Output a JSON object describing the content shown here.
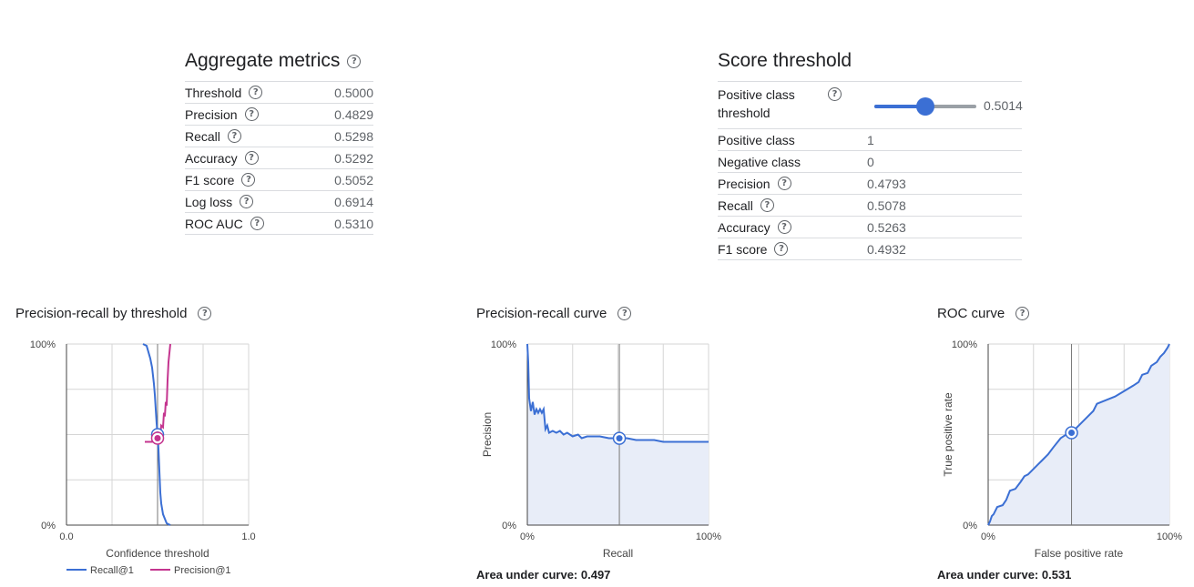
{
  "aggregate": {
    "title": "Aggregate metrics",
    "rows": [
      {
        "name": "Threshold",
        "value": "0.5000"
      },
      {
        "name": "Precision",
        "value": "0.4829"
      },
      {
        "name": "Recall",
        "value": "0.5298"
      },
      {
        "name": "Accuracy",
        "value": "0.5292"
      },
      {
        "name": "F1 score",
        "value": "0.5052"
      },
      {
        "name": "Log loss",
        "value": "0.6914"
      },
      {
        "name": "ROC AUC",
        "value": "0.5310"
      }
    ]
  },
  "score_threshold": {
    "title": "Score threshold",
    "pos_threshold_label_1": "Positive class",
    "pos_threshold_label_2": "threshold",
    "slider_value": "0.5014",
    "slider_fraction": 0.5014,
    "rows": [
      {
        "name": "Positive class",
        "value": "1",
        "help": false
      },
      {
        "name": "Negative class",
        "value": "0",
        "help": false
      },
      {
        "name": "Precision",
        "value": "0.4793",
        "help": true
      },
      {
        "name": "Recall",
        "value": "0.5078",
        "help": true
      },
      {
        "name": "Accuracy",
        "value": "0.5263",
        "help": true
      },
      {
        "name": "F1 score",
        "value": "0.4932",
        "help": true
      }
    ]
  },
  "colors": {
    "recall": "#3b6fd4",
    "precision": "#c4358f",
    "fill": "#e8edf8",
    "grid": "#d6d6d6",
    "accent": "#3b6fd4"
  },
  "chart_data": [
    {
      "type": "line",
      "title": "Precision-recall by threshold",
      "xlabel": "Confidence threshold",
      "ylabel": "",
      "x_ticks": [
        "0.0",
        "1.0"
      ],
      "y_ticks": [
        "0%",
        "100%"
      ],
      "xlim": [
        0,
        1
      ],
      "ylim": [
        0,
        1
      ],
      "threshold": 0.5,
      "series": [
        {
          "name": "Recall@1",
          "color": "#3b6fd4",
          "x": [
            0.42,
            0.44,
            0.46,
            0.47,
            0.48,
            0.485,
            0.49,
            0.495,
            0.5,
            0.505,
            0.51,
            0.515,
            0.52,
            0.53,
            0.55,
            0.57
          ],
          "y": [
            1.0,
            0.99,
            0.92,
            0.87,
            0.78,
            0.72,
            0.64,
            0.56,
            0.5,
            0.42,
            0.3,
            0.18,
            0.12,
            0.06,
            0.01,
            0.0
          ]
        },
        {
          "name": "Precision@1",
          "color": "#c4358f",
          "x": [
            0.43,
            0.45,
            0.47,
            0.48,
            0.485,
            0.49,
            0.495,
            0.5,
            0.505,
            0.51,
            0.515,
            0.52,
            0.53,
            0.535,
            0.54,
            0.545,
            0.55,
            0.555,
            0.56,
            0.57
          ],
          "y": [
            0.46,
            0.46,
            0.46,
            0.47,
            0.45,
            0.49,
            0.48,
            0.49,
            0.48,
            0.5,
            0.49,
            0.55,
            0.54,
            0.62,
            0.6,
            0.68,
            0.66,
            0.8,
            0.9,
            1.0
          ]
        }
      ],
      "marker": {
        "recall": [
          0.5,
          0.5
        ],
        "precision": [
          0.5,
          0.48
        ]
      }
    },
    {
      "type": "area",
      "title": "Precision-recall curve",
      "xlabel": "Recall",
      "ylabel": "Precision",
      "x_ticks": [
        "0%",
        "100%"
      ],
      "y_ticks": [
        "0%",
        "100%"
      ],
      "xlim": [
        0,
        1
      ],
      "ylim": [
        0,
        1
      ],
      "threshold_x": 0.5078,
      "auc_text": "Area under curve: 0.497",
      "series": [
        {
          "name": "",
          "color": "#3b6fd4",
          "x": [
            0.0,
            0.005,
            0.01,
            0.02,
            0.03,
            0.04,
            0.05,
            0.06,
            0.07,
            0.08,
            0.09,
            0.1,
            0.11,
            0.12,
            0.14,
            0.16,
            0.18,
            0.2,
            0.22,
            0.25,
            0.28,
            0.3,
            0.33,
            0.35,
            0.4,
            0.45,
            0.5,
            0.55,
            0.6,
            0.65,
            0.7,
            0.75,
            0.8,
            0.85,
            0.9,
            0.95,
            1.0
          ],
          "y": [
            1.0,
            0.9,
            0.7,
            0.63,
            0.68,
            0.61,
            0.64,
            0.62,
            0.64,
            0.62,
            0.64,
            0.53,
            0.55,
            0.51,
            0.52,
            0.51,
            0.52,
            0.5,
            0.51,
            0.49,
            0.5,
            0.48,
            0.49,
            0.49,
            0.49,
            0.48,
            0.48,
            0.48,
            0.47,
            0.47,
            0.47,
            0.46,
            0.46,
            0.46,
            0.46,
            0.46,
            0.46
          ]
        }
      ],
      "marker": [
        0.5078,
        0.4793
      ]
    },
    {
      "type": "area",
      "title": "ROC curve",
      "xlabel": "False positive rate",
      "ylabel": "True positive rate",
      "x_ticks": [
        "0%",
        "100%"
      ],
      "y_ticks": [
        "0%",
        "100%"
      ],
      "xlim": [
        0,
        1
      ],
      "ylim": [
        0,
        1
      ],
      "threshold_x": 0.46,
      "auc_text": "Area under curve: 0.531",
      "series": [
        {
          "name": "",
          "color": "#3b6fd4",
          "x": [
            0.0,
            0.01,
            0.02,
            0.03,
            0.05,
            0.08,
            0.1,
            0.12,
            0.15,
            0.18,
            0.2,
            0.22,
            0.25,
            0.28,
            0.3,
            0.33,
            0.36,
            0.4,
            0.43,
            0.46,
            0.5,
            0.55,
            0.58,
            0.6,
            0.65,
            0.7,
            0.75,
            0.8,
            0.83,
            0.85,
            0.88,
            0.9,
            0.93,
            0.95,
            0.97,
            0.99,
            1.0
          ],
          "y": [
            0.0,
            0.02,
            0.05,
            0.06,
            0.1,
            0.11,
            0.14,
            0.19,
            0.2,
            0.24,
            0.27,
            0.28,
            0.31,
            0.34,
            0.36,
            0.39,
            0.43,
            0.48,
            0.5,
            0.51,
            0.55,
            0.6,
            0.63,
            0.67,
            0.69,
            0.71,
            0.74,
            0.77,
            0.79,
            0.83,
            0.84,
            0.88,
            0.9,
            0.93,
            0.95,
            0.98,
            1.0
          ]
        }
      ],
      "marker": [
        0.46,
        0.51
      ]
    }
  ],
  "legend": {
    "recall": "Recall@1",
    "precision": "Precision@1"
  }
}
